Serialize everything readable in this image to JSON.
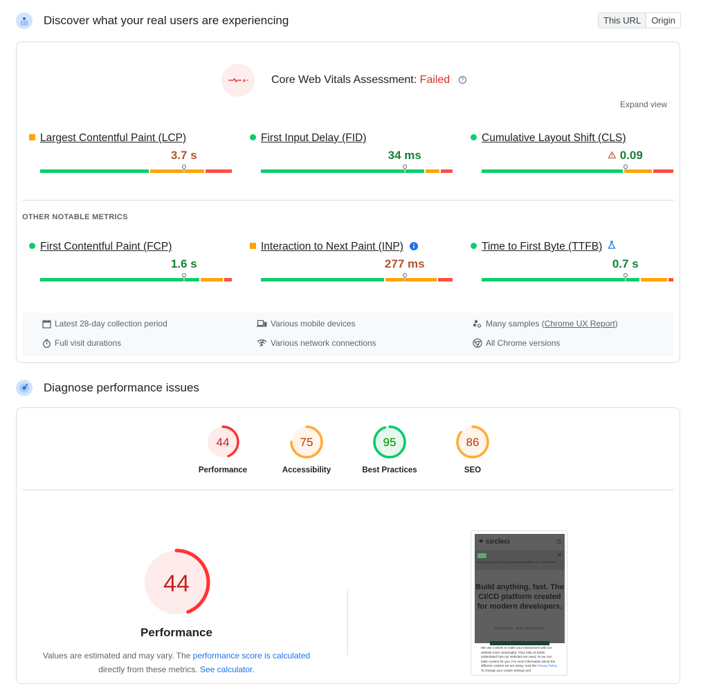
{
  "field_section": {
    "title": "Discover what your real users are experiencing",
    "toggle": [
      {
        "label": "This URL",
        "active": true
      },
      {
        "label": "Origin",
        "active": false
      }
    ],
    "assessment": {
      "label": "Core Web Vitals Assessment:",
      "status": "Failed",
      "status_color": "#d93025",
      "help_icon": "?"
    },
    "expand_label": "Expand view",
    "core_metrics": [
      {
        "id": "lcp",
        "name": "Largest Contentful Paint (LCP)",
        "value": "3.7 s",
        "rating": "needs-improvement",
        "indicator": "square",
        "distribution": {
          "good": 0.57,
          "ni": 0.29,
          "poor": 0.14
        },
        "p75_fraction": 0.75
      },
      {
        "id": "fid",
        "name": "First Input Delay (FID)",
        "value": "34 ms",
        "rating": "good",
        "indicator": "circle",
        "distribution": {
          "good": 0.855,
          "ni": 0.08,
          "poor": 0.065
        },
        "p75_fraction": 0.75
      },
      {
        "id": "cls",
        "name": "Cumulative Layout Shift (CLS)",
        "value": "0.09",
        "rating": "good",
        "indicator": "circle",
        "warning_icon": true,
        "distribution": {
          "good": 0.74,
          "ni": 0.15,
          "poor": 0.11
        },
        "p75_fraction": 0.75
      }
    ],
    "other_label": "OTHER NOTABLE METRICS",
    "other_metrics": [
      {
        "id": "fcp",
        "name": "First Contentful Paint (FCP)",
        "value": "1.6 s",
        "rating": "good",
        "indicator": "circle",
        "distribution": {
          "good": 0.835,
          "ni": 0.12,
          "poor": 0.045
        },
        "p75_fraction": 0.75
      },
      {
        "id": "inp",
        "name": "Interaction to Next Paint (INP)",
        "value": "277 ms",
        "rating": "needs-improvement",
        "indicator": "square",
        "info_icon": true,
        "distribution": {
          "good": 0.645,
          "ni": 0.275,
          "poor": 0.08
        },
        "p75_fraction": 0.75
      },
      {
        "id": "ttfb",
        "name": "Time to First Byte (TTFB)",
        "value": "0.7 s",
        "rating": "good",
        "indicator": "circle",
        "lab_icon": true,
        "distribution": {
          "good": 0.825,
          "ni": 0.145,
          "poor": 0.03
        },
        "p75_fraction": 0.75
      }
    ],
    "info": {
      "period": "Latest 28-day collection period",
      "durations": "Full visit durations",
      "devices": "Various mobile devices",
      "network": "Various network connections",
      "samples_prefix": "Many samples (",
      "samples_link": "Chrome UX Report",
      "samples_suffix": ")",
      "versions": "All Chrome versions"
    }
  },
  "lab_section": {
    "title": "Diagnose performance issues",
    "scores": [
      {
        "label": "Performance",
        "score": 44,
        "rating": "poor"
      },
      {
        "label": "Accessibility",
        "score": 75,
        "rating": "average"
      },
      {
        "label": "Best Practices",
        "score": 95,
        "rating": "pass"
      },
      {
        "label": "SEO",
        "score": 86,
        "rating": "average"
      }
    ],
    "main_score": {
      "label": "Performance",
      "score": 44
    },
    "note": {
      "text1": "Values are estimated and may vary. The ",
      "link1": "performance score is calculated",
      "text2": " directly from these metrics. ",
      "link2": "See calculator."
    },
    "screenshot": {
      "logo": "circleci",
      "badge": "NEW",
      "banner_text": "Arm support on the Docker executor available now. Get started →",
      "headline": "Build anything, fast. The CI/CD platform created for modern developers.",
      "subline": "Start for free. Scale without limits.",
      "cookie_text": "We use cookies to make your interactions with our website more meaningful. They help us better understand how our websites are used, so we can tailor content for you. For more information about the different cookies we are using, read the ",
      "cookie_link": "Privacy Policy",
      "cookie_tail": ". To change your cookie settings and"
    }
  },
  "colors": {
    "good": "#0cce6b",
    "ni": "#ffa400",
    "poor": "#ff4e42",
    "good_text": "#188038",
    "ni_text": "#b0562a",
    "poor_text": "#c5221f"
  }
}
